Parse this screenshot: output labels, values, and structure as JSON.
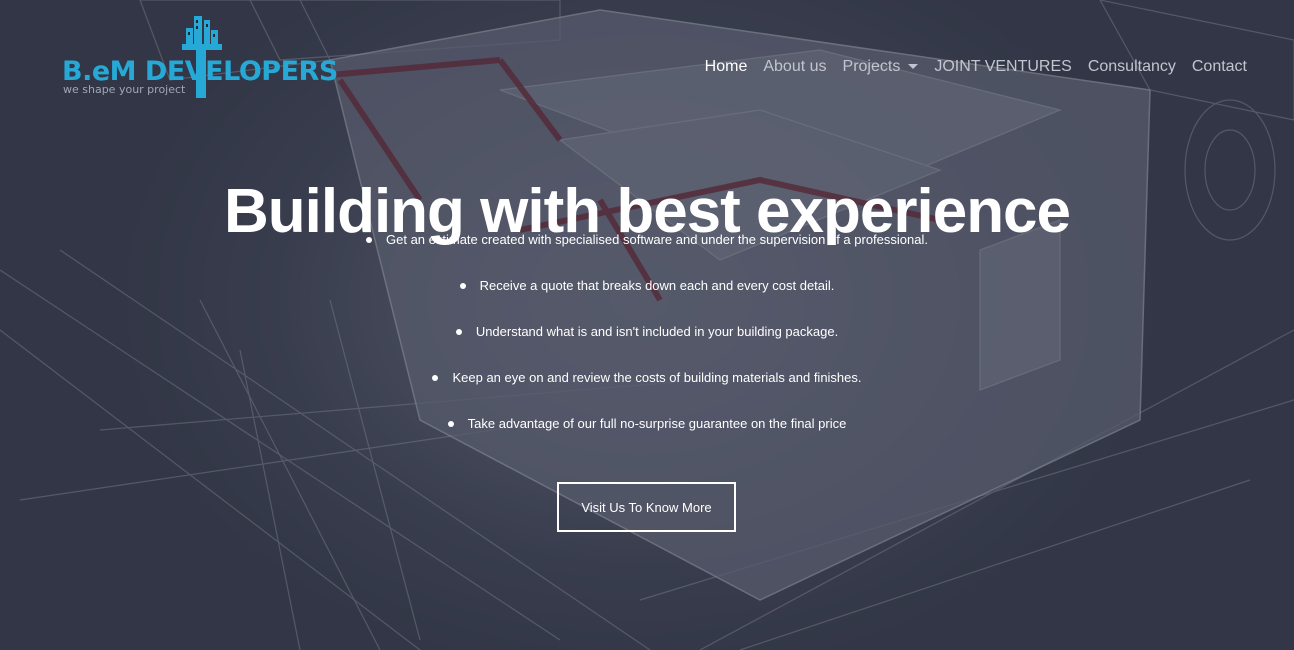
{
  "brand": {
    "name": "B.eM DEVELOPERS",
    "tagline": "we shape your project",
    "color": "#27a9d8"
  },
  "nav": {
    "items": [
      {
        "label": "Home",
        "active": true
      },
      {
        "label": "About us",
        "active": false
      },
      {
        "label": "Projects",
        "active": false,
        "dropdown": true
      },
      {
        "label": "JOINT VENTURES",
        "active": false
      },
      {
        "label": "Consultancy",
        "active": false
      },
      {
        "label": "Contact",
        "active": false
      }
    ]
  },
  "hero": {
    "title": "Building with best experience",
    "features": [
      "Get an estimate created with specialised software and under the supervision of a professional.",
      "Receive a quote that breaks down each and every cost detail.",
      "Understand what is and isn't included in your building package.",
      "Keep an eye on and review the costs of building materials and finishes.",
      "Take advantage of our full no-surprise guarantee on the final price"
    ],
    "cta_label": "Visit Us To Know More"
  }
}
